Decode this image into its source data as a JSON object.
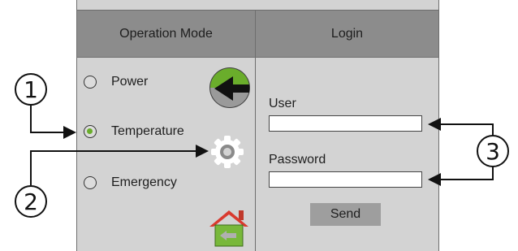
{
  "operation_mode": {
    "header": "Operation Mode",
    "options": [
      {
        "label": "Power",
        "selected": false,
        "icon": "power-plug-icon"
      },
      {
        "label": "Temperature",
        "selected": true,
        "icon": "gear-icon"
      },
      {
        "label": "Emergency",
        "selected": false,
        "icon": "home-back-icon"
      }
    ]
  },
  "login": {
    "header": "Login",
    "user_label": "User",
    "user_value": "",
    "password_label": "Password",
    "password_value": "",
    "send_label": "Send"
  },
  "callouts": [
    "1",
    "2",
    "3"
  ],
  "colors": {
    "panel_bg": "#d3d3d3",
    "header_bg": "#8c8c8c",
    "accent_green": "#6aad2b",
    "button_bg": "#9e9e9e"
  }
}
